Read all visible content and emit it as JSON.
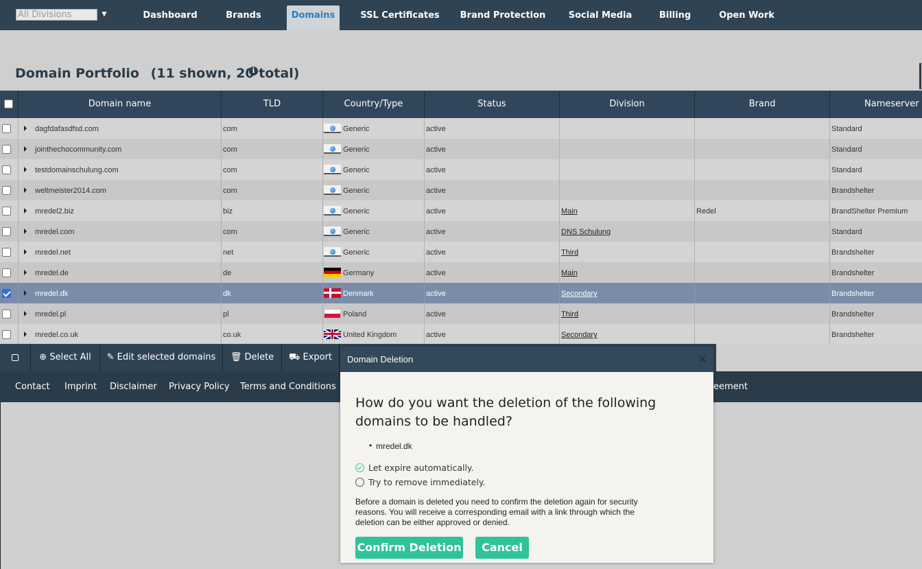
{
  "nav": {
    "division_placeholder": "All Divisions",
    "tabs": [
      {
        "label": "Dashboard"
      },
      {
        "label": "Brands"
      },
      {
        "label": "Domains"
      },
      {
        "label": "SSL Certificates"
      },
      {
        "label": "Brand Protection"
      },
      {
        "label": "Social Media"
      },
      {
        "label": "Billing"
      },
      {
        "label": "Open Work"
      }
    ],
    "active_tab": "Domains"
  },
  "portfolio": {
    "title": "Domain Portfolio",
    "count": "(11 shown, 20 total)"
  },
  "table": {
    "columns": [
      "Domain name",
      "TLD",
      "Country/Type",
      "Status",
      "Division",
      "Brand",
      "Nameserver s"
    ],
    "rows": [
      {
        "domain": "dagfdafasdfsd.com",
        "tld": "com",
        "flag": "generic",
        "country": "Generic",
        "status": "active",
        "division": "",
        "brand": "",
        "nameserver": "Standard",
        "checked": false
      },
      {
        "domain": "jointhechocommunity.com",
        "tld": "com",
        "flag": "generic",
        "country": "Generic",
        "status": "active",
        "division": "",
        "brand": "",
        "nameserver": "Standard",
        "checked": false
      },
      {
        "domain": "testdomainschulung.com",
        "tld": "com",
        "flag": "generic",
        "country": "Generic",
        "status": "active",
        "division": "",
        "brand": "",
        "nameserver": "Standard",
        "checked": false
      },
      {
        "domain": "weltmeister2014.com",
        "tld": "com",
        "flag": "generic",
        "country": "Generic",
        "status": "active",
        "division": "",
        "brand": "",
        "nameserver": "Brandshelter",
        "checked": false
      },
      {
        "domain": "mredel2.biz",
        "tld": "biz",
        "flag": "generic",
        "country": "Generic",
        "status": "active",
        "division": "Main",
        "brand": "Redel",
        "nameserver": "BrandShelter Premium",
        "checked": false
      },
      {
        "domain": "mredel.com",
        "tld": "com",
        "flag": "generic",
        "country": "Generic",
        "status": "active",
        "division": "DNS Schulung",
        "brand": "",
        "nameserver": "Standard",
        "checked": false
      },
      {
        "domain": "mredel.net",
        "tld": "net",
        "flag": "generic",
        "country": "Generic",
        "status": "active",
        "division": "Third",
        "brand": "",
        "nameserver": "Brandshelter",
        "checked": false
      },
      {
        "domain": "mredel.de",
        "tld": "de",
        "flag": "germany",
        "country": "Germany",
        "status": "active",
        "division": "Main",
        "brand": "",
        "nameserver": "Brandshelter",
        "checked": false
      },
      {
        "domain": "mredel.dk",
        "tld": "dk",
        "flag": "denmark",
        "country": "Denmark",
        "status": "active",
        "division": "Secondary",
        "brand": "",
        "nameserver": "Brandshelter",
        "checked": true
      },
      {
        "domain": "mredel.pl",
        "tld": "pl",
        "flag": "poland",
        "country": "Poland",
        "status": "active",
        "division": "Third",
        "brand": "",
        "nameserver": "Brandshelter",
        "checked": false
      },
      {
        "domain": "mredel.co.uk",
        "tld": "co.uk",
        "flag": "uk",
        "country": "United Kingdom",
        "status": "active",
        "division": "Secondary",
        "brand": "",
        "nameserver": "Brandshelter",
        "checked": false
      }
    ]
  },
  "toolbar": {
    "select_all": "Select All",
    "edit_selected": "Edit selected domains",
    "delete": "Delete",
    "export": "Export"
  },
  "footer": {
    "links": [
      "Contact",
      "Imprint",
      "Disclaimer",
      "Privacy Policy",
      "Terms and Conditions"
    ],
    "hidden_tail": "eement"
  },
  "modal": {
    "title": "Domain Deletion",
    "question": "How do you want the deletion of the following domains to be handled?",
    "domains": [
      "mredel.dk"
    ],
    "option_expire": "Let expire automatically.",
    "option_remove": "Try to remove immediately.",
    "selected_option": "expire",
    "note": "Before a domain is deleted you need to confirm the deletion again for security reasons. You will receive a corresponding email with a link through which the deletion can be either approved or denied.",
    "confirm_label": "Confirm Deletion",
    "cancel_label": "Cancel"
  },
  "colors": {
    "nav_bg": "#2f4353",
    "accent_green": "#2ec39a",
    "active_tab_text": "#2a7dbb",
    "selected_row": "#7a8ca8"
  }
}
